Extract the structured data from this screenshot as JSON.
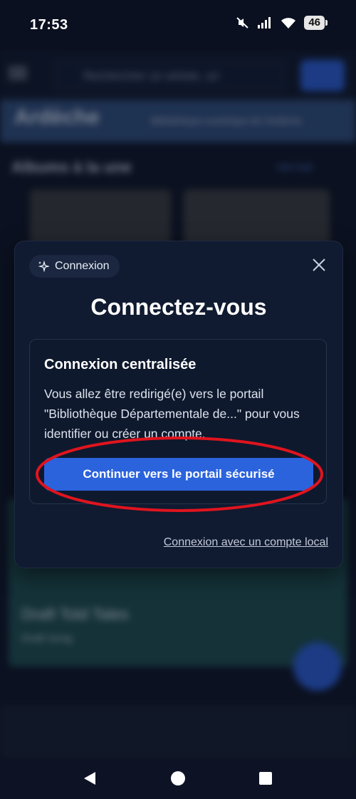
{
  "status_bar": {
    "time": "17:53",
    "battery": "46"
  },
  "background_app": {
    "search_placeholder": "Rechercher un artiste, un",
    "brand": "Ardèche",
    "brand_subtitle": "Bibliothèque numérique de l'Ardèche",
    "section_title": "Albums à la une",
    "see_all": "Voir tout",
    "tile_title": "Draft Told Tales",
    "tile_subtitle": "Draft Song"
  },
  "modal": {
    "badge_label": "Connexion",
    "title": "Connectez-vous",
    "card": {
      "heading": "Connexion centralisée",
      "description": "Vous allez être redirigé(e) vers le portail \"Bibliothèque Départementale de...\" pour vous identifier ou créer un compte.",
      "button_label": "Continuer vers le portail sécurisé"
    },
    "local_link": "Connexion avec un compte local"
  },
  "colors": {
    "accent": "#2b63dd",
    "modal_bg": "#101a30",
    "annotation": "#e0141e"
  },
  "icons": [
    "sparkle-icon",
    "close-icon",
    "mute-icon",
    "signal-icon",
    "wifi-icon",
    "battery-icon",
    "back-icon",
    "home-icon",
    "recents-icon"
  ]
}
